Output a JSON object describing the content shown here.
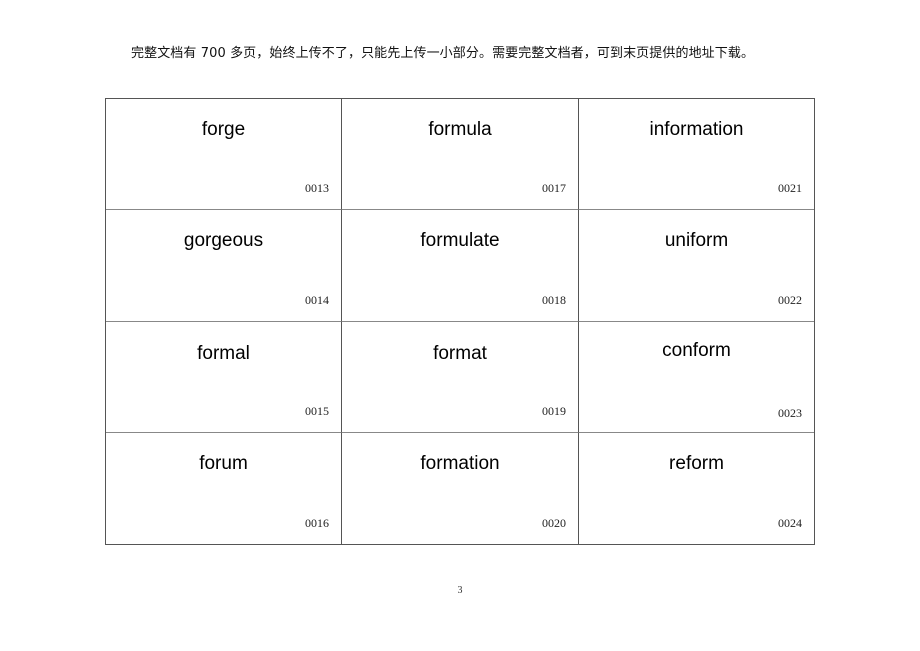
{
  "notice": "完整文档有 700 多页，始终上传不了，只能先上传一小部分。需要完整文档者，可到末页提供的地址下载。",
  "cards": [
    [
      {
        "word": "forge",
        "code": "0013"
      },
      {
        "word": "formula",
        "code": "0017"
      },
      {
        "word": "information",
        "code": "0021"
      }
    ],
    [
      {
        "word": "gorgeous",
        "code": "0014"
      },
      {
        "word": "formulate",
        "code": "0018"
      },
      {
        "word": "uniform",
        "code": "0022"
      }
    ],
    [
      {
        "word": "formal",
        "code": "0015"
      },
      {
        "word": "format",
        "code": "0019"
      },
      {
        "word": "conform",
        "code": "0023"
      }
    ],
    [
      {
        "word": "forum",
        "code": "0016"
      },
      {
        "word": "formation",
        "code": "0020"
      },
      {
        "word": "reform",
        "code": "0024"
      }
    ]
  ],
  "page_number": "3"
}
